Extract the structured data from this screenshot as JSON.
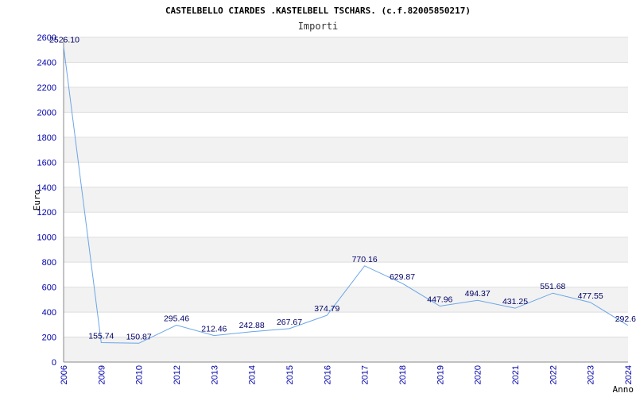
{
  "chart_data": {
    "type": "line",
    "title": "CASTELBELLO CIARDES .KASTELBELL TSCHARS. (c.f.82005850217)",
    "subtitle": "Importi",
    "xlabel": "Anno",
    "ylabel": "Euro",
    "ylim": [
      0,
      2600
    ],
    "yticks": [
      "0",
      "200",
      "400",
      "600",
      "800",
      "1000",
      "1200",
      "1400",
      "1600",
      "1800",
      "2000",
      "2200",
      "2400",
      "2600"
    ],
    "categories": [
      "2006",
      "2009",
      "2010",
      "2012",
      "2013",
      "2014",
      "2015",
      "2016",
      "2017",
      "2018",
      "2019",
      "2020",
      "2021",
      "2022",
      "2023",
      "2024"
    ],
    "values": [
      2526.1,
      155.74,
      150.87,
      295.46,
      212.46,
      242.88,
      267.67,
      374.79,
      770.16,
      629.87,
      447.96,
      494.37,
      431.25,
      551.68,
      477.55,
      292.6
    ],
    "value_labels": [
      "2526.10",
      "155.74",
      "150.87",
      "295.46",
      "212.46",
      "242.88",
      "267.67",
      "374.79",
      "770.16",
      "629.87",
      "447.96",
      "494.37",
      "431.25",
      "551.68",
      "477.55",
      "292.6"
    ],
    "grid": true,
    "colors": {
      "line": "#6aa6e8",
      "band": "#f2f2f2",
      "gridline": "#dddddd",
      "tick_text": "#0000aa",
      "value_text": "#000066"
    }
  }
}
